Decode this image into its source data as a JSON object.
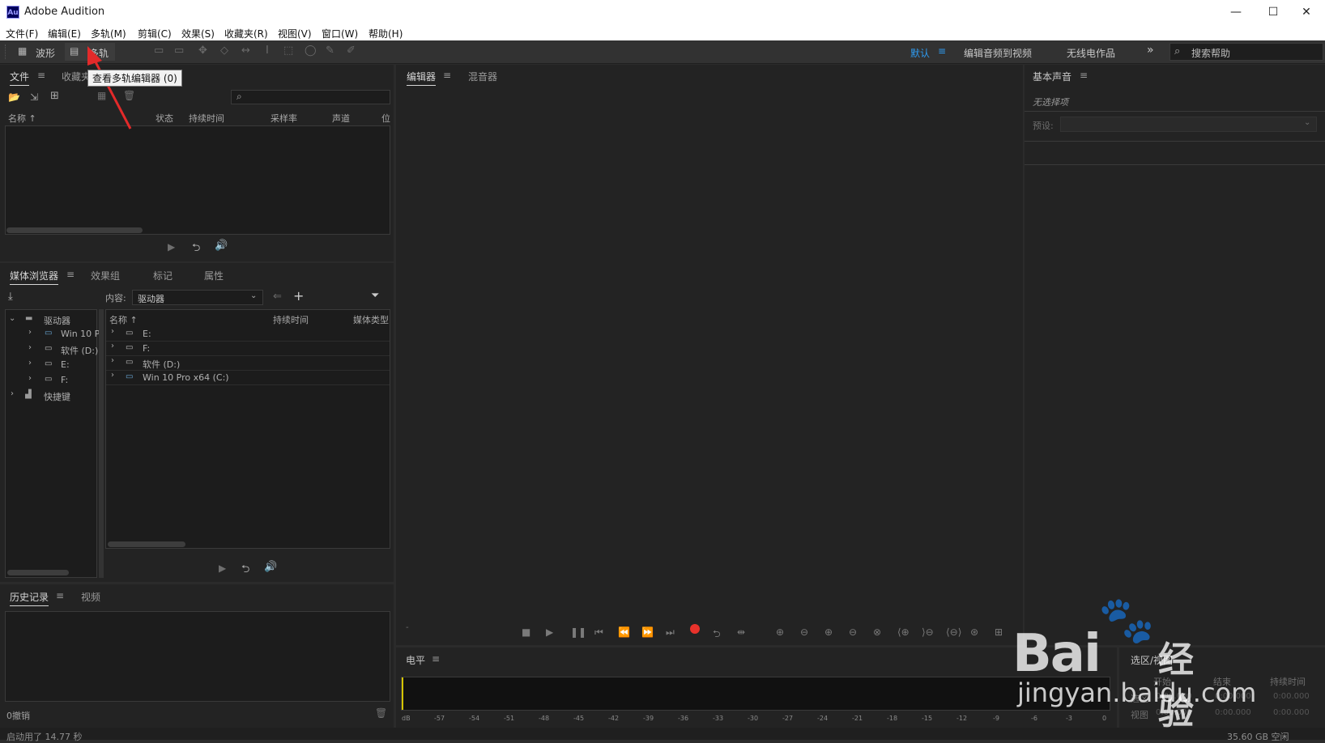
{
  "app": {
    "title": "Adobe Audition",
    "icon_text": "Au"
  },
  "window_controls": {
    "minimize": "—",
    "maximize": "☐",
    "close": "✕"
  },
  "menu": [
    "文件(F)",
    "编辑(E)",
    "多轨(M)",
    "剪辑(C)",
    "效果(S)",
    "收藏夹(R)",
    "视图(V)",
    "窗口(W)",
    "帮助(H)"
  ],
  "toolbar": {
    "waveform_label": "波形",
    "multitrack_label": "多轨",
    "workspaces": [
      "默认",
      "编辑音频到视频",
      "无线电作品"
    ],
    "more": "»",
    "search_placeholder": "搜索帮助"
  },
  "tooltip": {
    "text": "查看多轨编辑器 (0)"
  },
  "files_panel": {
    "tabs": [
      "文件",
      "收藏夹"
    ],
    "columns": [
      "名称 ↑",
      "状态",
      "持续时间",
      "采样率",
      "声道",
      "位"
    ]
  },
  "media_panel": {
    "tabs": [
      "媒体浏览器",
      "效果组",
      "标记",
      "属性"
    ],
    "content_label": "内容:",
    "content_value": "驱动器",
    "tree": [
      {
        "label": "驱动器",
        "level": 0,
        "expanded": true,
        "icon": "drive-group-icon"
      },
      {
        "label": "Win 10 P",
        "level": 1,
        "expanded": false,
        "icon": "system-drive-icon"
      },
      {
        "label": "软件 (D:)",
        "level": 1,
        "expanded": false,
        "icon": "drive-icon"
      },
      {
        "label": "E:",
        "level": 1,
        "expanded": false,
        "icon": "drive-icon"
      },
      {
        "label": "F:",
        "level": 1,
        "expanded": false,
        "icon": "drive-icon"
      },
      {
        "label": "快捷键",
        "level": 0,
        "expanded": false,
        "icon": "shortcut-icon"
      }
    ],
    "columns": [
      "名称 ↑",
      "持续时间",
      "媒体类型"
    ],
    "rows": [
      "E:",
      "F:",
      "软件 (D:)",
      "Win 10 Pro x64 (C:)"
    ]
  },
  "history_panel": {
    "tabs": [
      "历史记录",
      "视频"
    ],
    "undo_text": "0撤销"
  },
  "editor_panel": {
    "tabs": [
      "编辑器",
      "混音器"
    ]
  },
  "essential_sound": {
    "title": "基本声音",
    "no_selection": "无选择项",
    "preset_label": "预设:"
  },
  "level_panel": {
    "title": "电平",
    "scale": [
      "dB",
      "-57",
      "-54",
      "-51",
      "-48",
      "-45",
      "-42",
      "-39",
      "-36",
      "-33",
      "-30",
      "-27",
      "-24",
      "-21",
      "-18",
      "-15",
      "-12",
      "-9",
      "-6",
      "-3",
      "0"
    ]
  },
  "selection_panel": {
    "title": "选区/视图",
    "headers": [
      "开始",
      "结束",
      "持续时间"
    ],
    "rows": [
      {
        "label": "选区",
        "start": "0:00.000",
        "end": "0:00.000",
        "duration": "0:00.000"
      },
      {
        "label": "视图",
        "start": "0:00.000",
        "end": "0:00.000",
        "duration": "0:00.000"
      }
    ]
  },
  "status": {
    "left": "启动用了 14.77 秒",
    "right": "35.60 GB 空闲"
  },
  "watermark": {
    "brand": "Bai",
    "brand_cn": "经验",
    "url": "jingyan.baidu.com"
  },
  "colors": {
    "accent": "#2e9bf0",
    "record": "#e8322b",
    "playhead": "#d4c400"
  }
}
